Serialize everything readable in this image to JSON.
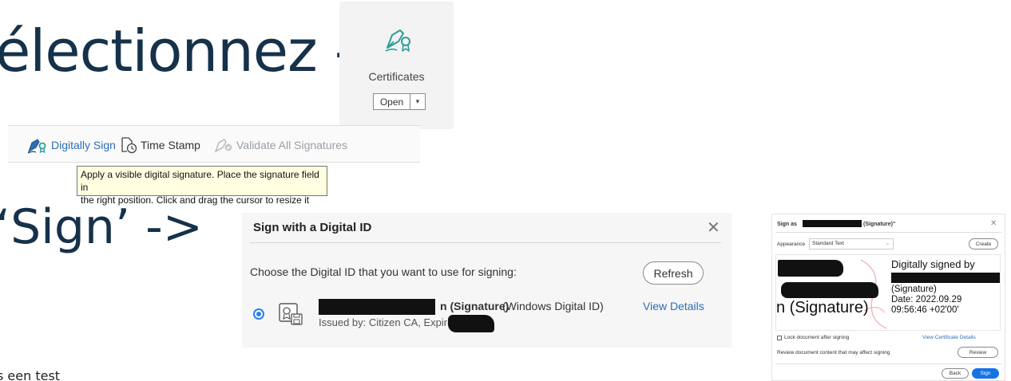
{
  "slide": {
    "select_text": "électionnez ->",
    "sign_text": "‘Sign’ ->",
    "cut_text": "s een test"
  },
  "certificates_panel": {
    "label": "Certificates",
    "open_button": "Open",
    "icon": "certificate-pen-icon"
  },
  "toolbar": {
    "digitally_sign": "Digitally Sign",
    "time_stamp": "Time Stamp",
    "validate_all": "Validate All Signatures"
  },
  "tooltip": {
    "line1": "Apply a visible digital signature. Place the signature field in",
    "line2": "the right position. Click and drag the cursor to resize it"
  },
  "digital_id_dialog": {
    "title": "Sign with a Digital ID",
    "prompt": "Choose the Digital ID that you want to use for signing:",
    "refresh_button": "Refresh",
    "id_name_suffix": "n (Signature)",
    "id_type": "(Windows Digital ID)",
    "issued_by": "Issued by: Citizen CA, Expires:",
    "view_details": "View Details",
    "close": "✕",
    "accent": "#2680eb"
  },
  "sign_as_dialog": {
    "title_prefix": "Sign as",
    "title_suffix": "(Signature)\"",
    "close": "✕",
    "appearance_label": "Appearance",
    "appearance_value": "Standard Text",
    "create_button": "Create",
    "preview_name": "n (Signature)",
    "preview_line1": "Digitally signed by",
    "preview_line3": "(Signature)",
    "preview_line4": "Date: 2022.09.29",
    "preview_line5": "09:56:46 +02'00'",
    "lock_label": "Lock document after signing",
    "view_certificate": "View Certificate Details",
    "review_label": "Review document content that may affect signing",
    "review_button": "Review",
    "back_button": "Back",
    "sign_button": "Sign",
    "primary_color": "#1473e6"
  }
}
